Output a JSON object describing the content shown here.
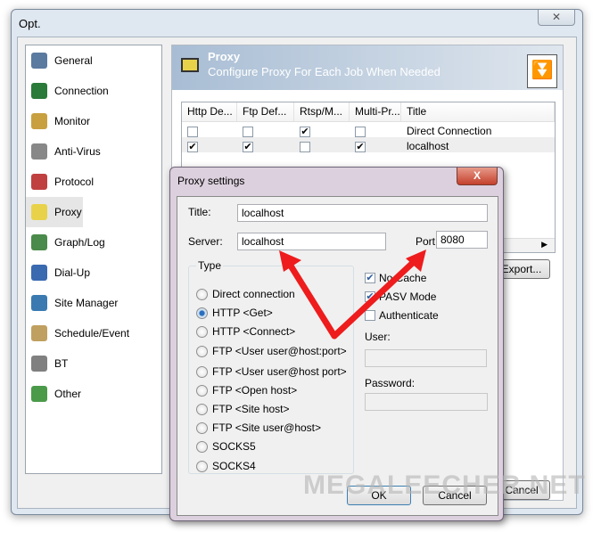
{
  "window": {
    "title": "Opt.",
    "close_icon": "close-icon"
  },
  "sidebar": {
    "items": [
      {
        "label": "General",
        "color": "#5a7aa0"
      },
      {
        "label": "Connection",
        "color": "#2a7a3a"
      },
      {
        "label": "Monitor",
        "color": "#c8a040"
      },
      {
        "label": "Anti-Virus",
        "color": "#888"
      },
      {
        "label": "Protocol",
        "color": "#c04040"
      },
      {
        "label": "Proxy",
        "color": "#e8d24a"
      },
      {
        "label": "Graph/Log",
        "color": "#4a8a4a"
      },
      {
        "label": "Dial-Up",
        "color": "#3a6ab0"
      },
      {
        "label": "Site Manager",
        "color": "#3a7ab0"
      },
      {
        "label": "Schedule/Event",
        "color": "#c0a060"
      },
      {
        "label": "BT",
        "color": "#808080"
      },
      {
        "label": "Other",
        "color": "#4a9a4a"
      }
    ],
    "selected": "Proxy"
  },
  "header": {
    "title": "Proxy",
    "subtitle": "Configure Proxy For Each Job When Needed"
  },
  "table": {
    "columns": [
      "Http De...",
      "Ftp Def...",
      "Rtsp/M...",
      "Multi-Pr...",
      "Title"
    ],
    "rows": [
      {
        "checks": [
          false,
          false,
          true,
          false
        ],
        "title": "Direct Connection"
      },
      {
        "checks": [
          true,
          true,
          false,
          true
        ],
        "title": "localhost"
      }
    ]
  },
  "buttons": {
    "export": "Export...",
    "cancel": "Cancel"
  },
  "dialog": {
    "title": "Proxy settings",
    "title_label": "Title:",
    "title_value": "localhost",
    "server_label": "Server:",
    "server_value": "localhost",
    "port_label": "Port:",
    "port_value": "8080",
    "type_label": "Type",
    "types": [
      "Direct connection",
      "HTTP <Get>",
      "HTTP <Connect>",
      "FTP <User user@host:port>",
      "FTP <User user@host port>",
      "FTP <Open host>",
      "FTP <Site host>",
      "FTP <Site user@host>",
      "SOCKS5",
      "SOCKS4"
    ],
    "selected_type": "HTTP <Get>",
    "options": [
      {
        "label": "No Cache",
        "checked": true
      },
      {
        "label": "PASV Mode",
        "checked": true
      },
      {
        "label": "Authenticate",
        "checked": false
      }
    ],
    "user_label": "User:",
    "user_value": "",
    "password_label": "Password:",
    "password_value": "",
    "ok": "OK",
    "cancel": "Cancel"
  },
  "watermark": "MEGALEECHER.NET",
  "colors": {
    "arrow": "#ee1c1c",
    "header_gradient": "#a8bdd4"
  }
}
